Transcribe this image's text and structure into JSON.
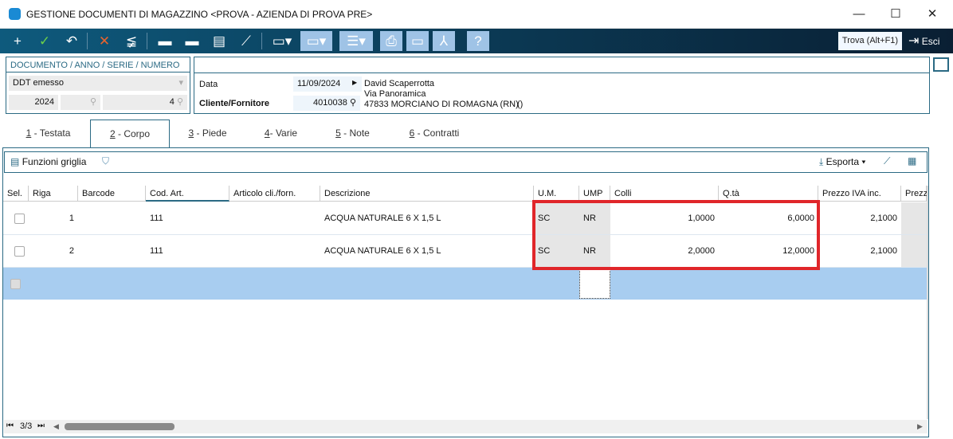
{
  "window": {
    "title": "GESTIONE DOCUMENTI DI MAGAZZINO <PROVA - AZIENDA DI PROVA PRE>"
  },
  "toolbar": {
    "trova": "Trova (Alt+F1)",
    "esci": "Esci"
  },
  "doc": {
    "header": "DOCUMENTO / ANNO / SERIE / NUMERO",
    "type": "DDT emesso",
    "anno": "2024",
    "serie": "",
    "numero": "4"
  },
  "info": {
    "data_label": "Data",
    "data": "11/09/2024",
    "cliente_label": "Cliente/Fornitore",
    "cliente_code": "4010038",
    "name": "David Scaperrotta",
    "address": "Via Panoramica",
    "city": "47833 MORCIANO DI ROMAGNA (RN)",
    "extra": "()"
  },
  "tabs": [
    {
      "n": "1",
      "label": " - Testata"
    },
    {
      "n": "2",
      "label": " - Corpo"
    },
    {
      "n": "3",
      "label": " - Piede"
    },
    {
      "n": "4",
      "label": "- Varie"
    },
    {
      "n": "5",
      "label": " - Note"
    },
    {
      "n": "6",
      "label": " - Contratti"
    }
  ],
  "grid": {
    "funzioni": "Funzioni griglia",
    "esporta": "Esporta",
    "columns": [
      "Sel.",
      "Riga",
      "Barcode",
      "Cod. Art.",
      "Articolo cli./forn.",
      "Descrizione",
      "U.M.",
      "UMP",
      "Colli",
      "Q.tà",
      "Prezzo IVA inc.",
      "Prezz"
    ],
    "rows": [
      {
        "riga": "1",
        "barcode": "",
        "cod": "111",
        "art": "",
        "desc": "ACQUA NATURALE 6 X 1,5 L",
        "um": "SC",
        "ump": "NR",
        "colli": "1,0000",
        "qta": "6,0000",
        "prezzo": "2,1000"
      },
      {
        "riga": "2",
        "barcode": "",
        "cod": "111",
        "art": "",
        "desc": "ACQUA NATURALE 6 X 1,5 L",
        "um": "SC",
        "ump": "NR",
        "colli": "2,0000",
        "qta": "12,0000",
        "prezzo": "2,1000"
      }
    ],
    "pager": "3/3"
  },
  "colors": {
    "accent": "#2b6a84",
    "highlight": "#e0262a",
    "newrow": "#a8cdf0"
  }
}
